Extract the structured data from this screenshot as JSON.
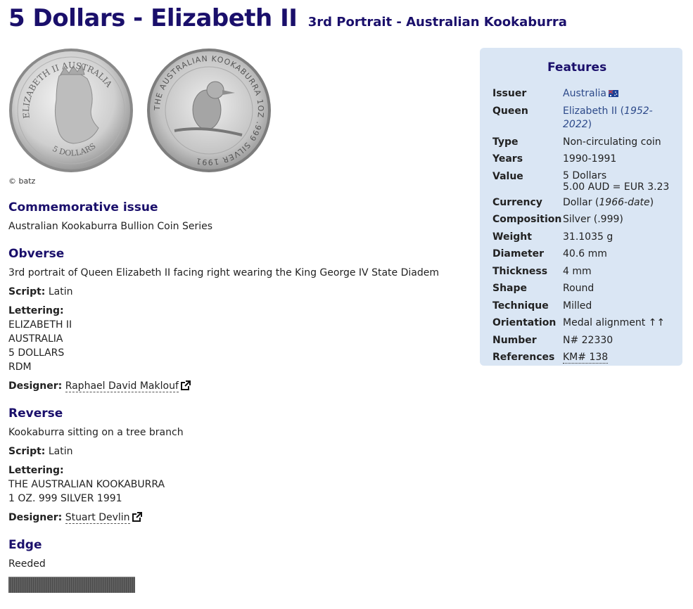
{
  "header": {
    "title": "5 Dollars - Elizabeth II",
    "subtitle": "3rd Portrait - Australian Kookaburra"
  },
  "images": {
    "obverse_text_top": "ELIZABETH II AUSTRALIA",
    "obverse_text_bottom": "5 DOLLARS",
    "reverse_text": "THE AUSTRALIAN KOOKABURRA 1OZ .999 SILVER 1991",
    "credit": "© batz"
  },
  "commemorative": {
    "heading": "Commemorative issue",
    "text": "Australian Kookaburra Bullion Coin Series"
  },
  "obverse": {
    "heading": "Obverse",
    "description": "3rd portrait of Queen Elizabeth II facing right wearing the King George IV State Diadem",
    "script_label": "Script:",
    "script_value": "Latin",
    "lettering_label": "Lettering:",
    "lettering": [
      "ELIZABETH II",
      "AUSTRALIA",
      "5 DOLLARS",
      "RDM"
    ],
    "designer_label": "Designer:",
    "designer_name": "Raphael David Maklouf"
  },
  "reverse": {
    "heading": "Reverse",
    "description": "Kookaburra sitting on a tree branch",
    "script_label": "Script:",
    "script_value": "Latin",
    "lettering_label": "Lettering:",
    "lettering": [
      "THE AUSTRALIAN KOOKABURRA",
      "1 OZ. 999 SILVER 1991"
    ],
    "designer_label": "Designer:",
    "designer_name": "Stuart Devlin"
  },
  "edge": {
    "heading": "Edge",
    "text": "Reeded"
  },
  "features": {
    "heading": "Features",
    "issuer_label": "Issuer",
    "issuer_value": "Australia",
    "queen_label": "Queen",
    "queen_name": "Elizabeth II",
    "queen_reign_open": "(",
    "queen_reign": "1952-2022",
    "queen_reign_close": ")",
    "type_label": "Type",
    "type_value": "Non-circulating coin",
    "years_label": "Years",
    "years_value": "1990-1991",
    "value_label": "Value",
    "value_main": "5 Dollars",
    "value_conversion": "5.00 AUD = EUR 3.23",
    "currency_label": "Currency",
    "currency_value": "Dollar",
    "currency_period_open": "(",
    "currency_period": "1966-date",
    "currency_period_close": ")",
    "composition_label": "Composition",
    "composition_value": "Silver (.999)",
    "weight_label": "Weight",
    "weight_value": "31.1035 g",
    "diameter_label": "Diameter",
    "diameter_value": "40.6 mm",
    "thickness_label": "Thickness",
    "thickness_value": "4 mm",
    "shape_label": "Shape",
    "shape_value": "Round",
    "technique_label": "Technique",
    "technique_value": "Milled",
    "orientation_label": "Orientation",
    "orientation_value": "Medal alignment ↑↑",
    "number_label": "Number",
    "number_value": "N# 22330",
    "references_label": "References",
    "references_value": "KM# 138"
  },
  "colors": {
    "heading": "#1a0f6b",
    "panel_bg": "#dae6f4",
    "link": "#2d4a8a"
  }
}
